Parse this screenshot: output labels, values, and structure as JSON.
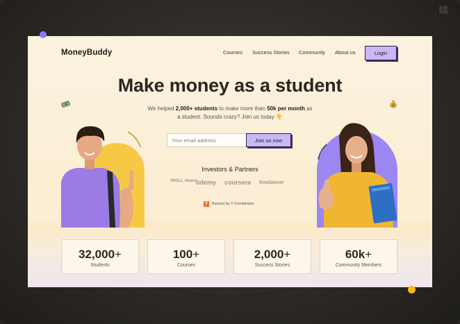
{
  "brand": "MoneyBuddy",
  "nav": {
    "links": [
      "Courses",
      "Success Stories",
      "Community",
      "About us"
    ],
    "login_label": "Login"
  },
  "hero": {
    "title": "Make money as a student",
    "sub_prefix": "We helped ",
    "sub_students": "2,000+ students",
    "sub_middle": " to make more than ",
    "sub_amount": "50k per month",
    "sub_suffix": " as",
    "sub_line2": "a student. Sounds crazy?  Join us today 👇"
  },
  "signup": {
    "email_placeholder": "Your email address",
    "join_label": "Join us now"
  },
  "investors": {
    "title": "Investors & Partners",
    "partners": [
      "SKILL share.",
      "ûdemy",
      "coursera",
      "freelancer"
    ],
    "backed_by": "Backed by Y Combinator",
    "yc_letter": "Y"
  },
  "stats": [
    {
      "value": "32,000",
      "plus": "+",
      "label": "Students"
    },
    {
      "value": "100",
      "plus": "+",
      "label": "Courses"
    },
    {
      "value": "2,000",
      "plus": "+",
      "label": "Success Stories"
    },
    {
      "value": "60k",
      "plus": "+",
      "label": "Community Members"
    }
  ],
  "colors": {
    "accent_purple": "#c9b8f5",
    "arch_yellow": "#f6c945",
    "arch_purple": "#9b86f2",
    "dot_yellow": "#f6b81c"
  },
  "icons": [
    "money-bill-icon",
    "money-bag-icon",
    "windows-logo-icon"
  ]
}
